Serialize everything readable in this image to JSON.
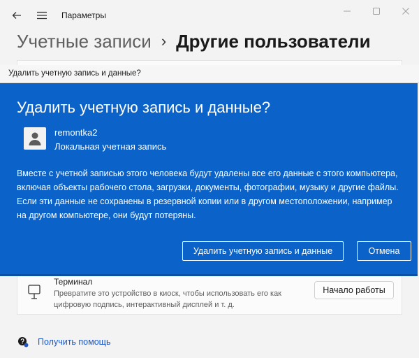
{
  "window": {
    "title": "Параметры"
  },
  "breadcrumb": {
    "parent": "Учетные записи",
    "separator": "›",
    "current": "Другие пользователи"
  },
  "dialog": {
    "window_title": "Удалить учетную запись и данные?",
    "heading": "Удалить учетную запись и данные?",
    "account_name": "remontka2",
    "account_type": "Локальная учетная запись",
    "message": "Вместе с учетной записью этого человека будут удалены все его данные с этого компьютера, включая объекты рабочего стола, загрузки, документы, фотографии, музыку и другие файлы. Если эти данные не сохранены в резервной копии или в другом местоположении, например на другом компьютере, они будут потеряны.",
    "delete_label": "Удалить учетную запись и данные",
    "cancel_label": "Отмена"
  },
  "terminal": {
    "title": "Терминал",
    "description": "Превратите это устройство в киоск, чтобы использовать его как цифровую подпись, интерактивный дисплей и т. д.",
    "button_label": "Начало работы"
  },
  "help": {
    "label": "Получить помощь"
  },
  "colors": {
    "dialog_bg": "#0b62c9",
    "link": "#1a57c9"
  }
}
